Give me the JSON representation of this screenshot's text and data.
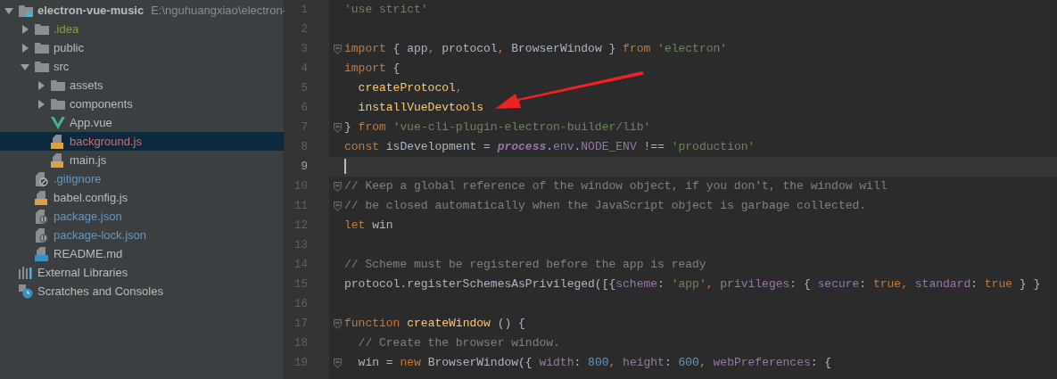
{
  "project_tree": [
    {
      "label": "electron-vue-music",
      "path": "E:\\nguhuangxiao\\electron-",
      "kind": "module",
      "expanded": true,
      "selected": false,
      "color": "#bbbbbb",
      "children": [
        {
          "label": ".idea",
          "kind": "folder",
          "expanded": false,
          "selected": false,
          "color": "#8f9d3c"
        },
        {
          "label": "public",
          "kind": "folder",
          "expanded": false,
          "selected": false,
          "color": "#bbbbbb"
        },
        {
          "label": "src",
          "kind": "folder",
          "expanded": true,
          "selected": false,
          "color": "#bbbbbb",
          "children": [
            {
              "label": "assets",
              "kind": "folder",
              "expanded": false,
              "selected": false,
              "color": "#bbbbbb"
            },
            {
              "label": "components",
              "kind": "folder",
              "expanded": false,
              "selected": false,
              "color": "#bbbbbb"
            },
            {
              "label": "App.vue",
              "kind": "vue",
              "selected": false,
              "color": "#bbbbbb"
            },
            {
              "label": "background.js",
              "kind": "js",
              "selected": true,
              "color": "#c77171"
            },
            {
              "label": "main.js",
              "kind": "js",
              "selected": false,
              "color": "#bbbbbb"
            }
          ]
        },
        {
          "label": ".gitignore",
          "kind": "gitignore",
          "selected": false,
          "color": "#6897bb"
        },
        {
          "label": "babel.config.js",
          "kind": "js",
          "selected": false,
          "color": "#bbbbbb"
        },
        {
          "label": "package.json",
          "kind": "json",
          "selected": false,
          "color": "#6897bb"
        },
        {
          "label": "package-lock.json",
          "kind": "json",
          "selected": false,
          "color": "#6897bb"
        },
        {
          "label": "README.md",
          "kind": "md",
          "selected": false,
          "color": "#bbbbbb"
        }
      ]
    },
    {
      "label": "External Libraries",
      "kind": "libraries",
      "selected": false,
      "color": "#bbbbbb"
    },
    {
      "label": "Scratches and Consoles",
      "kind": "scratches",
      "selected": false,
      "color": "#bbbbbb"
    }
  ],
  "editor_lines": [
    {
      "number": "1",
      "current": false,
      "fold_marker": false,
      "tokens": [
        {
          "kind": "str",
          "text": "'use strict'"
        }
      ]
    },
    {
      "number": "2",
      "current": false,
      "fold_marker": false
    },
    {
      "number": "3",
      "current": false,
      "fold_marker": true,
      "tokens": [
        {
          "kind": "kw",
          "text": "import"
        },
        {
          "kind": "plain",
          "text": " { app"
        },
        {
          "kind": "kw",
          "text": ","
        },
        {
          "kind": "plain",
          "text": " protocol"
        },
        {
          "kind": "kw",
          "text": ","
        },
        {
          "kind": "plain",
          "text": " BrowserWindow } "
        },
        {
          "kind": "kw",
          "text": "from"
        },
        {
          "kind": "str",
          "text": " 'electron'"
        }
      ]
    },
    {
      "number": "4",
      "current": false,
      "fold_marker": false,
      "tokens": [
        {
          "kind": "kw",
          "text": "import"
        },
        {
          "kind": "plain",
          "text": " {"
        }
      ]
    },
    {
      "number": "5",
      "current": false,
      "fold_marker": false,
      "tokens": [
        {
          "kind": "fn",
          "text": "  createProtocol"
        },
        {
          "kind": "kw",
          "text": ","
        }
      ]
    },
    {
      "number": "6",
      "current": false,
      "fold_marker": false,
      "tokens": [
        {
          "kind": "fn",
          "text": "  installVueDevtools"
        }
      ]
    },
    {
      "number": "7",
      "current": false,
      "fold_marker": true,
      "tokens": [
        {
          "kind": "plain",
          "text": "} "
        },
        {
          "kind": "kw",
          "text": "from"
        },
        {
          "kind": "str",
          "text": " 'vue-cli-plugin-electron-builder/lib'"
        }
      ]
    },
    {
      "number": "8",
      "current": false,
      "fold_marker": false,
      "tokens": [
        {
          "kind": "kw",
          "text": "const"
        },
        {
          "kind": "plain",
          "text": " isDevelopment = "
        },
        {
          "kind": "global",
          "text": "process"
        },
        {
          "kind": "plain",
          "text": "."
        },
        {
          "kind": "prop",
          "text": "env"
        },
        {
          "kind": "plain",
          "text": "."
        },
        {
          "kind": "prop",
          "text": "NODE_ENV"
        },
        {
          "kind": "plain",
          "text": " !== "
        },
        {
          "kind": "str",
          "text": "'production'"
        }
      ]
    },
    {
      "number": "9",
      "current": true,
      "fold_marker": false
    },
    {
      "number": "10",
      "current": false,
      "fold_marker": true,
      "tokens": [
        {
          "kind": "cmt",
          "text": "// Keep a global reference of the window object, if you don't, the window will"
        }
      ]
    },
    {
      "number": "11",
      "current": false,
      "fold_marker": true,
      "tokens": [
        {
          "kind": "cmt",
          "text": "// be closed automatically when the JavaScript object is garbage collected."
        }
      ]
    },
    {
      "number": "12",
      "current": false,
      "fold_marker": false,
      "tokens": [
        {
          "kind": "kw",
          "text": "let"
        },
        {
          "kind": "plain",
          "text": " win"
        }
      ]
    },
    {
      "number": "13",
      "current": false,
      "fold_marker": false
    },
    {
      "number": "14",
      "current": false,
      "fold_marker": false,
      "tokens": [
        {
          "kind": "cmt",
          "text": "// Scheme must be registered before the app is ready"
        }
      ]
    },
    {
      "number": "15",
      "current": false,
      "fold_marker": false,
      "tokens": [
        {
          "kind": "plain",
          "text": "protocol.registerSchemesAsPrivileged([{"
        },
        {
          "kind": "prop",
          "text": "scheme"
        },
        {
          "kind": "plain",
          "text": ": "
        },
        {
          "kind": "str",
          "text": "'app'"
        },
        {
          "kind": "kw",
          "text": ","
        },
        {
          "kind": "prop",
          "text": " privileges"
        },
        {
          "kind": "plain",
          "text": ": { "
        },
        {
          "kind": "prop",
          "text": "secure"
        },
        {
          "kind": "plain",
          "text": ": "
        },
        {
          "kind": "kw",
          "text": "true,"
        },
        {
          "kind": "prop",
          "text": " standard"
        },
        {
          "kind": "plain",
          "text": ": "
        },
        {
          "kind": "kw",
          "text": "true"
        },
        {
          "kind": "plain",
          "text": " } }"
        }
      ]
    },
    {
      "number": "16",
      "current": false,
      "fold_marker": false
    },
    {
      "number": "17",
      "current": false,
      "fold_marker": true,
      "tokens": [
        {
          "kind": "kw",
          "text": "function"
        },
        {
          "kind": "fn",
          "text": " createWindow"
        },
        {
          "kind": "plain",
          "text": " () {"
        }
      ]
    },
    {
      "number": "18",
      "current": false,
      "fold_marker": false,
      "tokens": [
        {
          "kind": "cmt",
          "text": "  // Create the browser window."
        }
      ]
    },
    {
      "number": "19",
      "current": false,
      "fold_marker": true,
      "tokens": [
        {
          "kind": "plain",
          "text": "  win = "
        },
        {
          "kind": "kw",
          "text": "new"
        },
        {
          "kind": "plain",
          "text": " BrowserWindow({ "
        },
        {
          "kind": "prop",
          "text": "width"
        },
        {
          "kind": "plain",
          "text": ": "
        },
        {
          "kind": "num",
          "text": "800"
        },
        {
          "kind": "kw",
          "text": ","
        },
        {
          "kind": "prop",
          "text": " height"
        },
        {
          "kind": "plain",
          "text": ": "
        },
        {
          "kind": "num",
          "text": "600"
        },
        {
          "kind": "kw",
          "text": ","
        },
        {
          "kind": "prop",
          "text": " webPreferences"
        },
        {
          "kind": "plain",
          "text": ": {"
        }
      ]
    }
  ]
}
